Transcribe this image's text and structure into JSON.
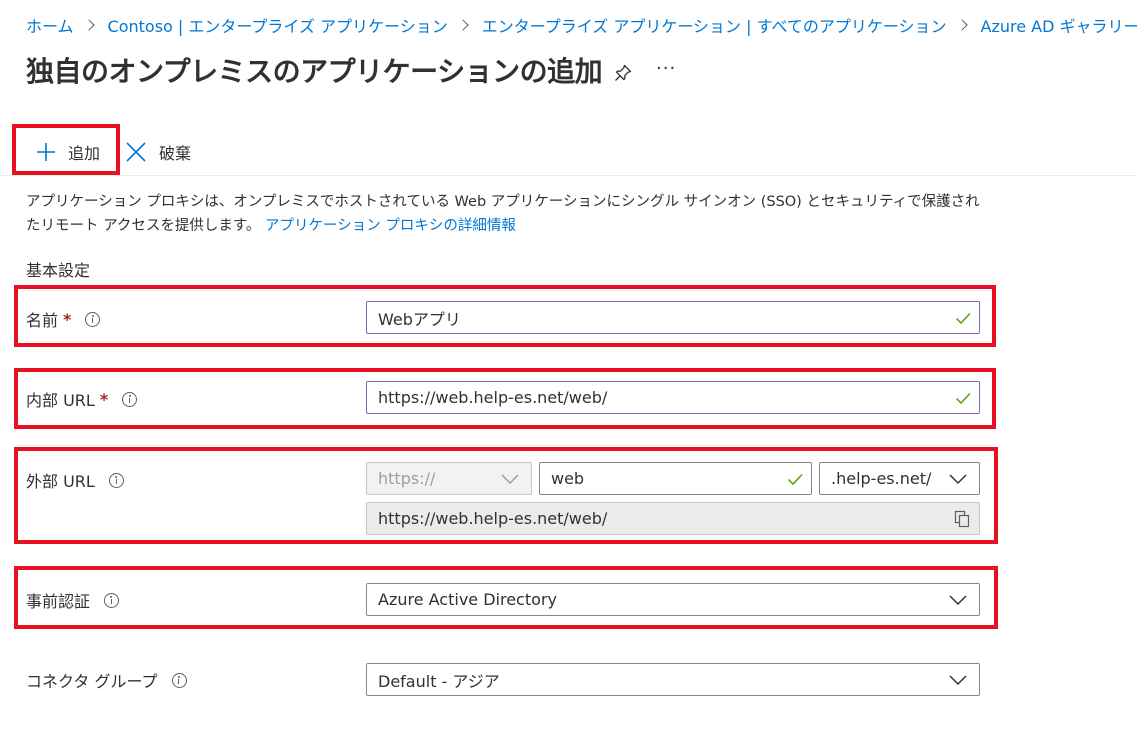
{
  "breadcrumb": [
    {
      "label": "ホーム"
    },
    {
      "label": "Contoso | エンタープライズ アプリケーション"
    },
    {
      "label": "エンタープライズ アプリケーション | すべてのアプリケーション"
    },
    {
      "label": "Azure AD ギャラリーの参照"
    }
  ],
  "page": {
    "title": "独自のオンプレミスのアプリケーションの追加",
    "more_label": "···"
  },
  "toolbar": {
    "add_label": "追加",
    "discard_label": "破棄"
  },
  "description": {
    "text": "アプリケーション プロキシは、オンプレミスでホストされている Web アプリケーションにシングル サインオン (SSO) とセキュリティで保護されたリモート アクセスを提供します。",
    "link": "アプリケーション プロキシの詳細情報"
  },
  "section": {
    "title": "基本設定"
  },
  "form": {
    "name": {
      "label": "名前",
      "required": "*",
      "value": "Webアプリ"
    },
    "internal_url": {
      "label": "内部 URL",
      "required": "*",
      "value": "https://web.help-es.net/web/"
    },
    "external_url": {
      "label": "外部 URL",
      "scheme": "https://",
      "subdomain": "web",
      "domain": ".help-es.net/",
      "full_url": "https://web.help-es.net/web/"
    },
    "preauth": {
      "label": "事前認証",
      "value": "Azure Active Directory"
    },
    "connector_group": {
      "label": "コネクタ グループ",
      "value": "Default - アジア"
    }
  },
  "icons": {
    "add": "plus-icon",
    "discard": "close-icon",
    "pin": "pin-icon",
    "info": "info-icon",
    "valid": "checkmark-icon",
    "dropdown": "chevron-down-icon",
    "copy": "copy-icon"
  },
  "colors": {
    "link": "#0078d4",
    "required": "#a4262c",
    "valid_check": "#57a300",
    "highlight": "#e81123"
  }
}
